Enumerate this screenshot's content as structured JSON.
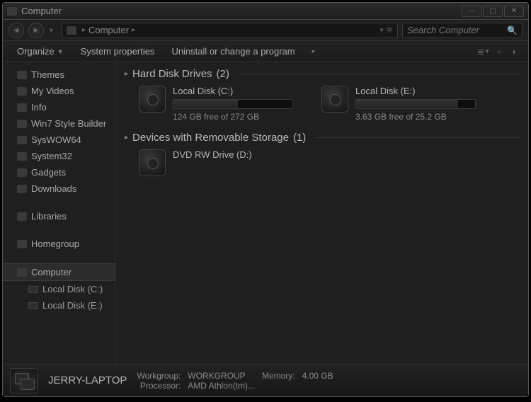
{
  "window": {
    "title": "Computer"
  },
  "breadcrumb": {
    "root_icon": "computer-icon",
    "item": "Computer"
  },
  "search": {
    "placeholder": "Search Computer"
  },
  "toolbar": {
    "organize": "Organize",
    "sys_props": "System properties",
    "uninstall": "Uninstall or change a program"
  },
  "sidebar": {
    "favorites": [
      "Themes",
      "My Videos",
      "Info",
      "Win7 Style Builder",
      "SysWOW64",
      "System32",
      "Gadgets",
      "Downloads"
    ],
    "libraries": "Libraries",
    "homegroup": "Homegroup",
    "computer": "Computer",
    "drives": [
      "Local Disk (C:)",
      "Local Disk (E:)"
    ]
  },
  "groups": {
    "hdd": {
      "label": "Hard Disk Drives",
      "count": "(2)"
    },
    "removable": {
      "label": "Devices with Removable Storage",
      "count": "(1)"
    }
  },
  "drives": {
    "c": {
      "name": "Local Disk (C:)",
      "free": "124 GB free of 272 GB",
      "used_pct": 54
    },
    "e": {
      "name": "Local Disk (E:)",
      "free": "3.63 GB free of 25.2 GB",
      "used_pct": 86
    },
    "d": {
      "name": "DVD RW Drive (D:)"
    }
  },
  "status": {
    "name": "JERRY-LAPTOP",
    "workgroup_lbl": "Workgroup:",
    "workgroup": "WORKGROUP",
    "memory_lbl": "Memory:",
    "memory": "4.00 GB",
    "processor_lbl": "Processor:",
    "processor": "AMD Athlon(tm)..."
  }
}
